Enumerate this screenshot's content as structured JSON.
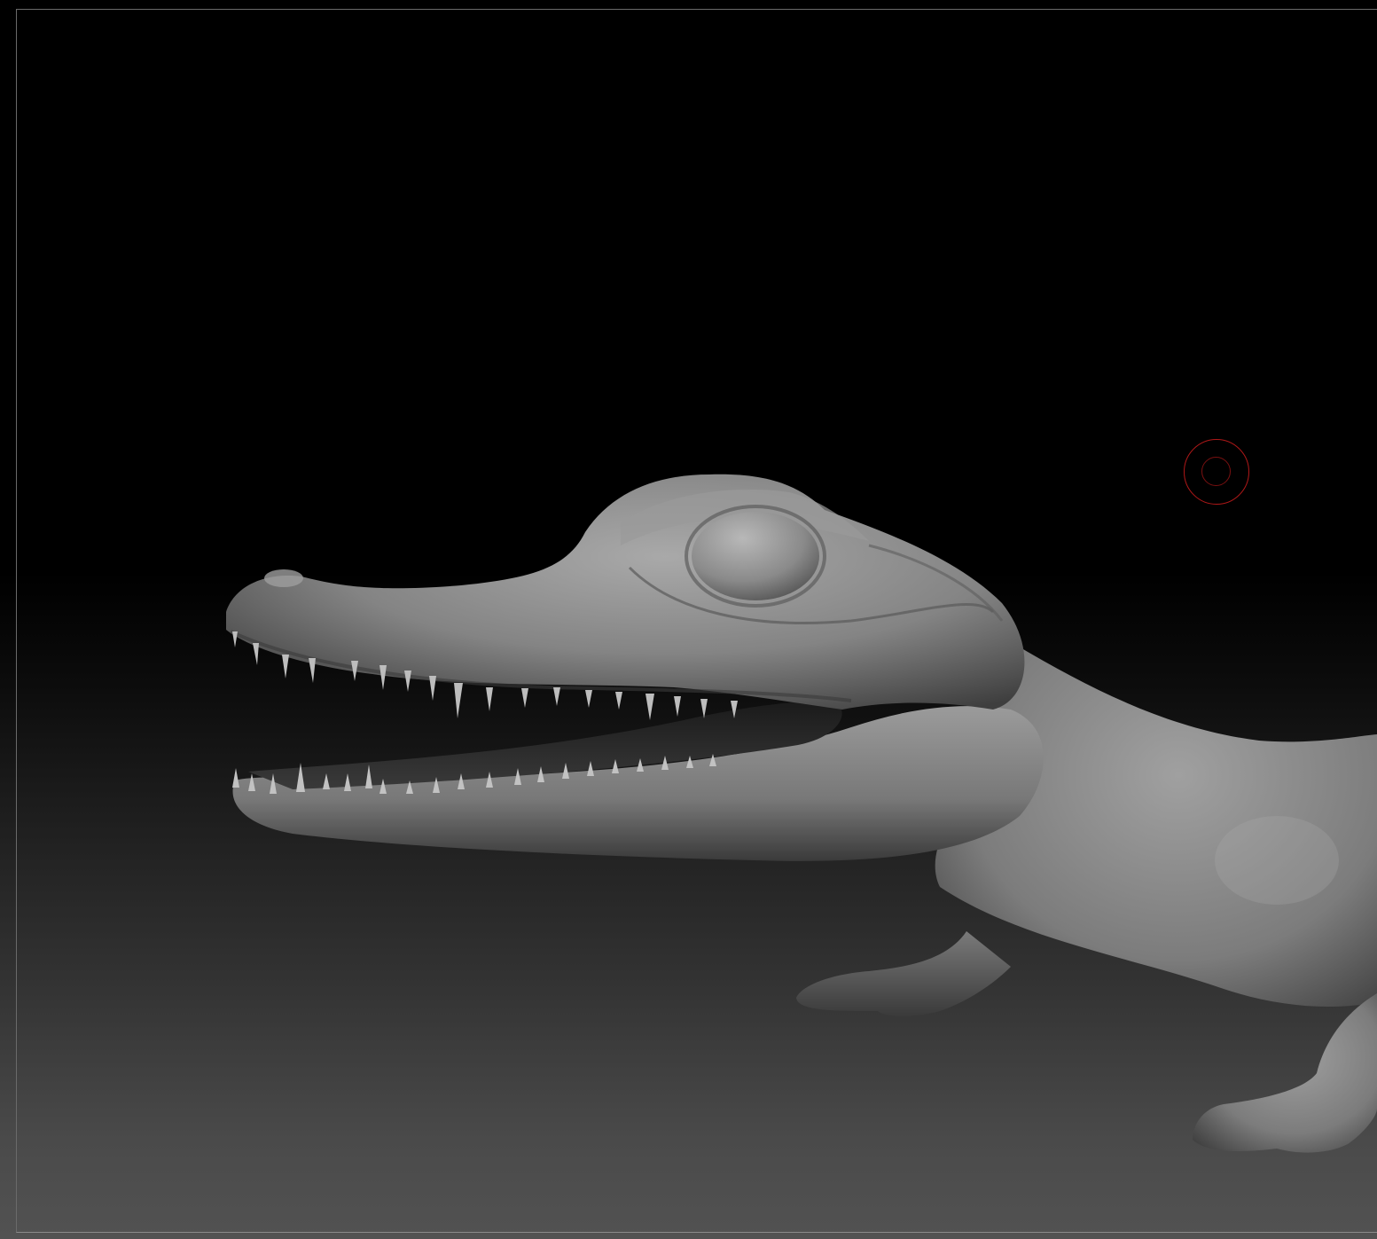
{
  "viewport": {
    "background_top": "#000000",
    "background_bottom": "#525252",
    "frame_color": "#6a6a6a"
  },
  "model": {
    "material_color": "#8e8e8e",
    "highlight_color": "#c8c8c8",
    "shadow_color": "#2a2a2a"
  },
  "cursor": {
    "icon": "brush-draw-size-icon",
    "color": "#b01818"
  }
}
